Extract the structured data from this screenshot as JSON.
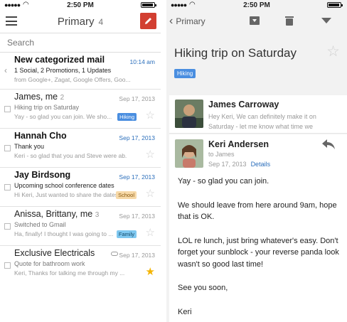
{
  "status": {
    "time": "2:50 PM"
  },
  "left": {
    "mailbox": "Primary",
    "unread_count": "4",
    "search_placeholder": "Search",
    "rows": [
      {
        "sender": "New categorized mail",
        "date": "10:14 am",
        "subject": "1 Social, 2 Promotions, 1 Updates",
        "snippet": "from Google+, Zagat, Google Offers, Goo..."
      },
      {
        "sender": "James, me",
        "count": "2",
        "date": "Sep 17, 2013",
        "subject": "Hiking trip on Saturday",
        "snippet": "Hey Keri, We can definitely make it on...",
        "snippet_shown": "Yay - so glad you can join. We sho...",
        "label": "Hiking"
      },
      {
        "sender": "Hannah Cho",
        "date": "Sep 17, 2013",
        "subject": "Thank you",
        "snippet": "Keri - so glad that you and Steve were ab..."
      },
      {
        "sender": "Jay Birdsong",
        "date": "Sep 17, 2013",
        "subject": "Upcoming school conference dates",
        "snippet": "Hi Keri, Just wanted to share the dates...",
        "label": "School"
      },
      {
        "sender": "Anissa, Brittany, me",
        "count": "3",
        "date": "Sep 17, 2013",
        "subject": "Switched to Gmail",
        "snippet": "Ha, finally! I thought I was going to ...",
        "label": "Family"
      },
      {
        "sender": "Exclusive Electricals",
        "date": "Sep 17, 2013",
        "subject": "Quote for bathroom work",
        "snippet": "Keri, Thanks for talking me through my ..."
      }
    ]
  },
  "right": {
    "back_label": "Primary",
    "subject": "Hiking trip on Saturday",
    "label": "Hiking",
    "msg1": {
      "from": "James Carroway",
      "preview": "Hey Keri, We can definitely make it on Saturday - let me know what time we"
    },
    "msg2": {
      "from": "Keri Andersen",
      "to": "to James",
      "date": "Sep 17, 2013",
      "details": "Details",
      "body": [
        "Yay - so glad you can join.",
        "We should leave from here around 9am, hope that is OK.",
        "LOL re lunch, just bring whatever's easy. Don't forget your sunblock - your reverse panda look wasn't so good last time!",
        "See you soon,",
        "Keri"
      ]
    }
  },
  "colors": {
    "compose": "#d23f31",
    "link": "#2a6ebb",
    "hiking_label": "#4a8ee0",
    "star": "#f4b400"
  }
}
